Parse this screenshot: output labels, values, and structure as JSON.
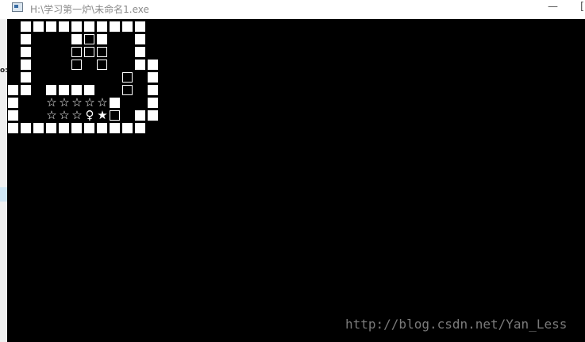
{
  "window": {
    "title": "H:\\学习第一炉\\未命名1.exe",
    "minimize_glyph": "—",
    "maximize_glyph": "[",
    "icon": "console-app-icon"
  },
  "edge_mark_text": "o:",
  "watermark": "http://blog.csdn.net/Yan_Less",
  "legend": {
    "#": "wall",
    "B": "box",
    "O": "star-target",
    "*": "box-on-target",
    "P": "player"
  },
  "symbols": {
    "star_target": "☆",
    "box_on_target": "★",
    "player": "♀"
  },
  "colors": {
    "console_bg": "#000000",
    "tile": "#ffffff"
  },
  "map": [
    " ##########",
    " #   #B#  #",
    " #   BBB  #",
    " #   B B  ##",
    " #       B #",
    "## ####  B #",
    "#  OOOOO#  #",
    "#  OOOP*B ##",
    "###########"
  ]
}
